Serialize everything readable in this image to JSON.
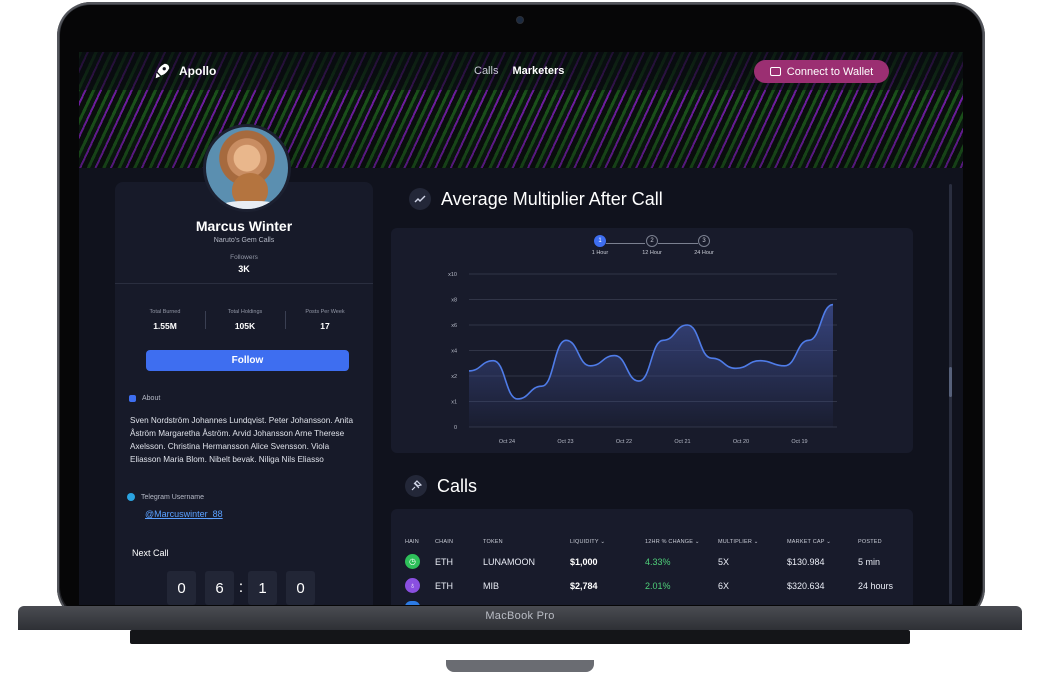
{
  "device": {
    "label": "MacBook Pro"
  },
  "header": {
    "app_name": "Apollo",
    "nav": [
      "Calls",
      "Marketers"
    ],
    "active_nav": "Marketers",
    "wallet_button": "Connect to Wallet"
  },
  "profile": {
    "name": "Marcus Winter",
    "subtitle": "Naruto's Gem Calls",
    "followers_label": "Followers",
    "followers": "3K",
    "stats": [
      {
        "label": "Total Burned",
        "value": "1.55M"
      },
      {
        "label": "Total Holdings",
        "value": "105K"
      },
      {
        "label": "Posts Per Week",
        "value": "17"
      }
    ],
    "follow_button": "Follow",
    "about_label": "About",
    "about_text": "Sven Nordström Johannes Lundqvist. Peter Johansson. Anita Åström Margaretha Åström. Arvid Johansson Arne Therese Axelsson. Christina Hermansson Alice Svensson. Viola Eliasson Maria Blom. Nibelt bevak. Niliga Nils Eliasso",
    "telegram_label": "Telegram Username",
    "telegram_user": "@Marcuswinter_88",
    "next_call_label": "Next Call",
    "timer_digits": [
      "0",
      "6",
      "1",
      "0"
    ]
  },
  "chart_section": {
    "title": "Average Multiplier After Call",
    "timeframes": [
      {
        "num": "1",
        "label": "1 Hour",
        "active": true
      },
      {
        "num": "2",
        "label": "12 Hour",
        "active": false
      },
      {
        "num": "3",
        "label": "24 Hour",
        "active": false
      }
    ]
  },
  "chart_data": {
    "type": "area",
    "y_ticks": [
      "0",
      "x1",
      "x2",
      "x4",
      "x6",
      "x8",
      "x10"
    ],
    "x_ticks": [
      "Oct 24",
      "Oct 23",
      "Oct 22",
      "Oct 21",
      "Oct 20",
      "Oct 19"
    ],
    "ylim": [
      0,
      6
    ],
    "grid": true,
    "series": [
      {
        "values": [
          2.2,
          2.6,
          1.1,
          1.6,
          3.4,
          2.4,
          2.8,
          1.8,
          3.4,
          4.0,
          2.7,
          2.3,
          2.6,
          2.4,
          3.4,
          4.8
        ]
      }
    ],
    "colors": {
      "line": "#4f7ce8",
      "fill": "#3b4a8a"
    }
  },
  "calls_section": {
    "title": "Calls",
    "columns": [
      "HAIN",
      "CHAIN",
      "TOKEN",
      "LIQUIDITY",
      "12HR % CHANGE",
      "MULTIPLIER",
      "MARKET CAP",
      "POSTED"
    ],
    "rows": [
      {
        "chain": "ETH",
        "token": "LUNAMOON",
        "liquidity": "$1,000",
        "change": "4.33%",
        "multiplier": "5X",
        "market_cap": "$130.984",
        "posted": "5 min",
        "icon_color": "#2ec05a"
      },
      {
        "chain": "ETH",
        "token": "MIB",
        "liquidity": "$2,784",
        "change": "2.01%",
        "multiplier": "6X",
        "market_cap": "$320.634",
        "posted": "24 hours",
        "icon_color": "#8a4fe0"
      }
    ]
  }
}
